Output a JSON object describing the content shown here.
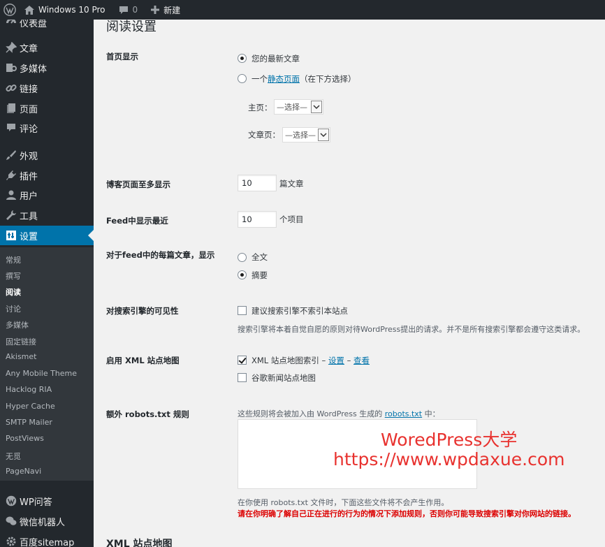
{
  "adminbar": {
    "site_name": "Windows 10 Pro",
    "comments_count": "0",
    "new_label": "新建"
  },
  "sidebar": {
    "items": [
      {
        "label": "仪表盘",
        "icon": "dashboard-icon"
      },
      {
        "label": "文章",
        "icon": "pin-icon"
      },
      {
        "label": "多媒体",
        "icon": "media-icon"
      },
      {
        "label": "链接",
        "icon": "link-icon"
      },
      {
        "label": "页面",
        "icon": "page-icon"
      },
      {
        "label": "评论",
        "icon": "comment-icon"
      },
      {
        "label": "外观",
        "icon": "brush-icon"
      },
      {
        "label": "插件",
        "icon": "plugin-icon"
      },
      {
        "label": "用户",
        "icon": "user-icon"
      },
      {
        "label": "工具",
        "icon": "wrench-icon"
      },
      {
        "label": "设置",
        "icon": "settings-icon"
      }
    ],
    "submenu": [
      "常规",
      "撰写",
      "阅读",
      "讨论",
      "多媒体",
      "固定链接",
      "Akismet",
      "Any Mobile Theme",
      "Hacklog RIA",
      "Hyper Cache",
      "SMTP Mailer",
      "PostViews",
      "无觅",
      "PageNavi"
    ],
    "bottom_items": [
      {
        "label": "WP问答",
        "icon": "wordpress-icon"
      },
      {
        "label": "微信机器人",
        "icon": "wechat-icon"
      },
      {
        "label": "百度sitemap",
        "icon": "gear-icon"
      }
    ]
  },
  "page": {
    "title": "阅读设置",
    "front_page": {
      "label": "首页显示",
      "option_latest": "您的最新文章",
      "option_static_prefix": "一个",
      "option_static_link": "静态页面",
      "option_static_suffix": "（在下方选择）",
      "home_label": "主页：",
      "posts_label": "文章页：",
      "select_placeholder": "—选择—"
    },
    "posts_per_page": {
      "label": "博客页面至多显示",
      "value": "10",
      "suffix": "篇文章"
    },
    "feed_items": {
      "label": "Feed中显示最近",
      "value": "10",
      "suffix": "个项目"
    },
    "feed_content": {
      "label": "对于feed中的每篇文章，显示",
      "option_full": "全文",
      "option_summary": "摘要"
    },
    "visibility": {
      "label": "对搜索引擎的可见性",
      "checkbox_label": "建议搜索引擎不索引本站点",
      "description": "搜索引擎将本着自觉自愿的原则对待WordPress提出的请求。并不是所有搜索引擎都会遵守这类请求。"
    },
    "xml_sitemap": {
      "label": "启用 XML 站点地图",
      "index_label": "XML 站点地图索引",
      "sep": "–",
      "settings_link": "设置",
      "view_link": "查看",
      "news_label": "谷歌新闻站点地图"
    },
    "robots": {
      "label": "额外 robots.txt 规则",
      "intro_prefix": "这些规则将会被加入由 WordPress 生成的 ",
      "intro_link": "robots.txt",
      "intro_suffix": " 中：",
      "note": "在你使用 robots.txt 文件时，下面这些文件将不会产生作用。",
      "warning": "请在你明确了解自己正在进行的行为的情况下添加规则，否则你可能导致搜索引擎对你网站的链接。"
    },
    "next_section_title": "XML 站点地图"
  },
  "watermark": {
    "line1": "WoredPress大学",
    "line2": "https://www.wpdaxue.com"
  },
  "colors": {
    "adminbar_bg": "#23282d",
    "menu_current": "#0073aa",
    "submenu_bg": "#32373c",
    "link": "#0073aa",
    "warning": "#dc0000",
    "watermark": "#e8322f"
  }
}
